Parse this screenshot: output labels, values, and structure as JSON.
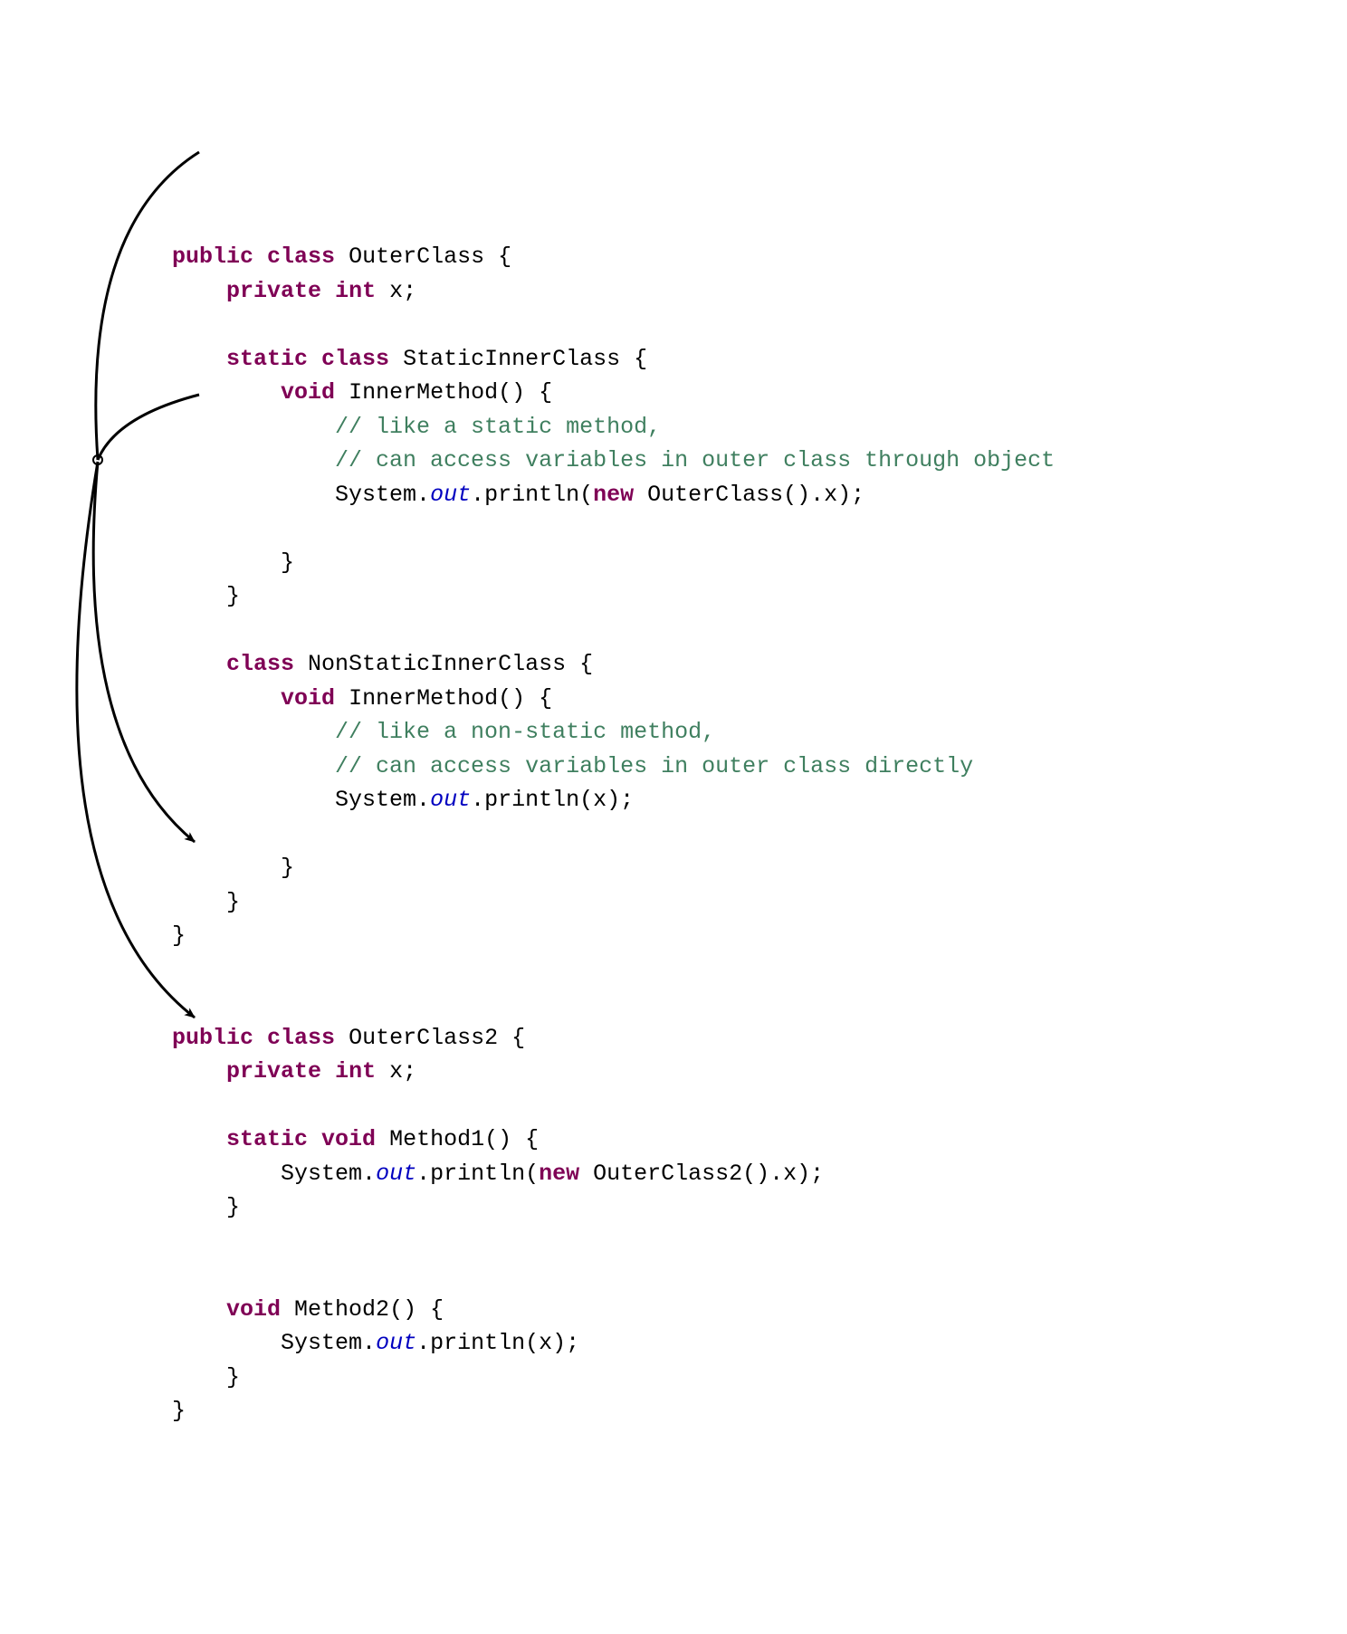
{
  "kw": {
    "public": "public",
    "class": "class",
    "private": "private",
    "int": "int",
    "static": "static",
    "void": "void",
    "new": "new"
  },
  "code1": {
    "className": "OuterClass",
    "lbrace": "{",
    "rbrace": "}",
    "field": {
      "name": "x",
      "semi": ";"
    },
    "inner1": {
      "name": "StaticInnerClass",
      "method": {
        "name": "InnerMethod()",
        "comment1": "// like a static method,",
        "comment2": "// can access variables in outer class through object",
        "stmt_prefix": "System.",
        "stmt_out": "out",
        "stmt_mid": ".println(",
        "stmt_instance": "OuterClass().x);"
      }
    },
    "inner2": {
      "name": "NonStaticInnerClass",
      "method": {
        "name": "InnerMethod()",
        "comment1": "// like a non-static method,",
        "comment2": "// can access variables in outer class directly",
        "stmt_prefix": "System.",
        "stmt_out": "out",
        "stmt_suffix": ".println(x);"
      }
    }
  },
  "code2": {
    "className": "OuterClass2",
    "lbrace": "{",
    "rbrace": "}",
    "field": {
      "name": "x",
      "semi": ";"
    },
    "m1": {
      "name": "Method1()",
      "stmt_prefix": "System.",
      "stmt_out": "out",
      "stmt_mid": ".println(",
      "stmt_instance": "OuterClass2().x);"
    },
    "m2": {
      "name": "Method2()",
      "stmt_prefix": "System.",
      "stmt_out": "out",
      "stmt_suffix": ".println(x);"
    }
  }
}
